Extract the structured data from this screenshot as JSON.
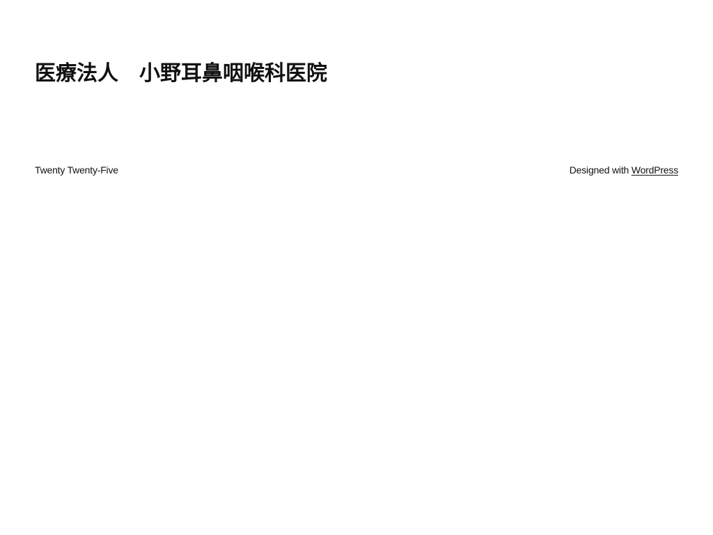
{
  "site": {
    "title": "医療法人　小野耳鼻咽喉科医院"
  },
  "footer": {
    "theme_name": "Twenty Twenty-Five",
    "credit_prefix": "Designed with",
    "credit_link": "WordPress"
  }
}
